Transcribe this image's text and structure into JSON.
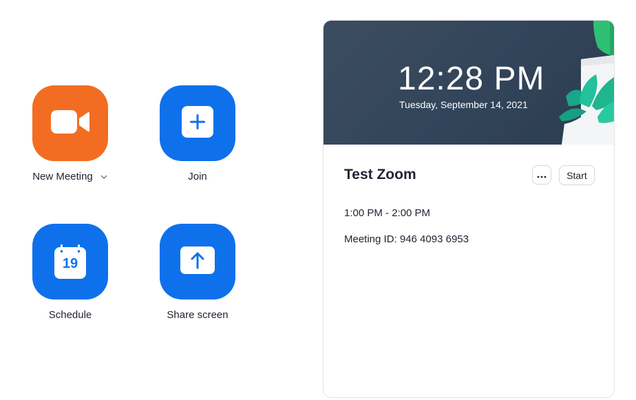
{
  "actions": {
    "new_meeting": {
      "label": "New Meeting",
      "icon": "video-camera-icon",
      "color": "#f26d21"
    },
    "join": {
      "label": "Join",
      "icon": "plus-icon",
      "color": "#0e71eb"
    },
    "schedule": {
      "label": "Schedule",
      "icon": "calendar-icon",
      "day": "19",
      "color": "#0e71eb"
    },
    "share_screen": {
      "label": "Share screen",
      "icon": "upload-arrow-icon",
      "color": "#0e71eb"
    }
  },
  "card": {
    "clock": "12:28 PM",
    "date": "Tuesday, September 14, 2021",
    "meeting_title": "Test Zoom",
    "more_label": "···",
    "start_label": "Start",
    "time_range": "1:00 PM - 2:00 PM",
    "meeting_id": "Meeting ID: 946 4093 6953"
  }
}
